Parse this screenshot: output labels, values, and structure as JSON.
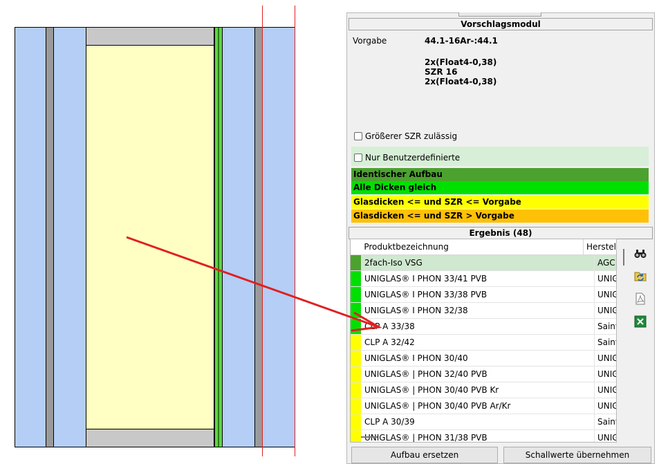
{
  "colors": {
    "identical": "#4ca22f",
    "all_equal": "#00e000",
    "le_le": "#ffff00",
    "le_gt": "#ffc107"
  },
  "module": {
    "title": "Vorschlagsmodul",
    "vorgabe_label": "Vorgabe",
    "vorgabe_value": "44.1-16Ar-:44.1",
    "detail_lines": [
      "2x(Float4-0,38)",
      "SZR 16",
      "2x(Float4-0,38)"
    ],
    "chk_larger_szr": "Größerer SZR zulässig",
    "chk_user_defined": "Nur Benutzerdefinierte"
  },
  "legend": [
    {
      "label": "Identischer Aufbau",
      "color": "#4ca22f"
    },
    {
      "label": "Alle Dicken gleich",
      "color": "#00e000"
    },
    {
      "label": "Glasdicken <= und SZR <= Vorgabe",
      "color": "#ffff00"
    },
    {
      "label": "Glasdicken <= und SZR > Vorgabe",
      "color": "#ffc107"
    }
  ],
  "result": {
    "title": "Ergebnis (48)",
    "col_name": "Produktbezeichnung",
    "col_maker": "Herstel",
    "rows": [
      {
        "name": "2fach-Iso VSG",
        "maker": "AGC In",
        "color": "#4ca22f"
      },
      {
        "name": "UNIGLAS® I PHON 33/41 PVB",
        "maker": "UNIGLA",
        "color": "#00e000"
      },
      {
        "name": "UNIGLAS® I PHON 33/38 PVB",
        "maker": "UNIGLA",
        "color": "#00e000"
      },
      {
        "name": "UNIGLAS® I PHON 32/38",
        "maker": "UNIGLA",
        "color": "#00e000"
      },
      {
        "name": "CLP A 33/38",
        "maker": "Saint G",
        "color": "#00e000"
      },
      {
        "name": "CLP A 32/42",
        "maker": "Saint G",
        "color": "#ffff00"
      },
      {
        "name": "UNIGLAS® I PHON 30/40",
        "maker": "UNIGLA",
        "color": "#ffff00"
      },
      {
        "name": "UNIGLAS® | PHON 32/40 PVB",
        "maker": "UNIGLA",
        "color": "#ffff00"
      },
      {
        "name": "UNIGLAS® | PHON 30/40 PVB Kr",
        "maker": "UNIGLA",
        "color": "#ffff00"
      },
      {
        "name": "UNIGLAS® | PHON 30/40 PVB Ar/Kr",
        "maker": "UNIGLA",
        "color": "#ffff00"
      },
      {
        "name": "CLP A 30/39",
        "maker": "Saint G",
        "color": "#ffff00"
      },
      {
        "name": "UNIGLAS® | PHON 31/38 PVB",
        "maker": "UNIGLA",
        "color": "#ffff00"
      }
    ]
  },
  "side_icons": [
    "binoculars-icon",
    "folder-refresh-icon",
    "pdf-icon",
    "excel-icon"
  ],
  "buttons": {
    "replace": "Aufbau ersetzen",
    "sound": "Schallwerte übernehmen"
  }
}
